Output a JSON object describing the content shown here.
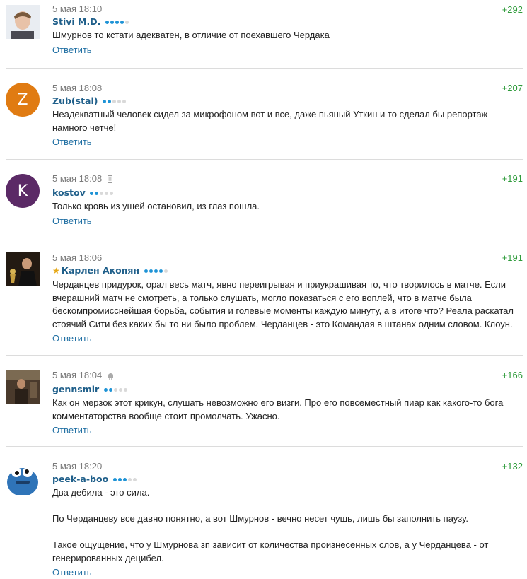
{
  "reply_label": "Ответить",
  "comments": [
    {
      "time": "5 мая 18:10",
      "author": "Stivi M.D.",
      "rating_dots": 4,
      "score": "+292",
      "text": [
        "Шмурнов то кстати адекватен, в отличие от поехавшего Чердака"
      ]
    },
    {
      "time": "5 мая 18:08",
      "author": "Zub(stal)",
      "rating_dots": 2,
      "score": "+207",
      "avatar_letter": "Z",
      "avatar_color": "#e07b12",
      "text": [
        "Неадекватный человек сидел за микрофоном вот и все, даже пьяный Уткин и то сделал бы репортаж намного четче!"
      ]
    },
    {
      "time": "5 мая 18:08",
      "author": "kostov",
      "rating_dots": 2,
      "score": "+191",
      "avatar_letter": "K",
      "avatar_color": "#5b2a66",
      "device_icon": "mobile-phone-icon",
      "text": [
        "Только кровь из ушей остановил, из глаз пошла."
      ]
    },
    {
      "time": "5 мая 18:06",
      "author": "Карлен Акопян",
      "rating_dots": 4,
      "score": "+191",
      "starred": true,
      "text": [
        "Черданцев придурок, орал весь матч, явно переигрывая и приукрашивая то, что творилось в матче. Если вчерашний матч не смотреть, а только слушать, могло показаться с его воплей, что в матче была бескомпромисснейшая борьба, события и голевые моменты каждую минуту, а в итоге что? Реала раскатал стоячий Сити без каких бы то ни было проблем. Черданцев - это Командая в штанах одним словом. Клоун."
      ]
    },
    {
      "time": "5 мая 18:04",
      "author": "gennsmir",
      "rating_dots": 2,
      "score": "+166",
      "device_icon": "android-icon",
      "text": [
        "Как он мерзок этот крикун, слушать невозможно его визги. Про его повсеместный пиар как какого-то бога комментаторства вообще стоит промолчать. Ужасно."
      ]
    },
    {
      "time": "5 мая 18:20",
      "author": "peek-a-boo",
      "rating_dots": 3,
      "score": "+132",
      "text": [
        "Два дебила - это сила.",
        "По Черданцеву все давно понятно, а вот Шмурнов - вечно несет чушь, лишь бы заполнить паузу.",
        "Такое ощущение, что у Шмурнова зп зависит от количества произнесенных слов, а у Черданцева - от генерированных децибел."
      ]
    }
  ],
  "colors": {
    "author": "#1f5f8a",
    "reply_link": "#1f6fa3",
    "score": "#2e9b3a",
    "rating_on": "#1e93d6",
    "rating_off": "#d9d9d9"
  }
}
